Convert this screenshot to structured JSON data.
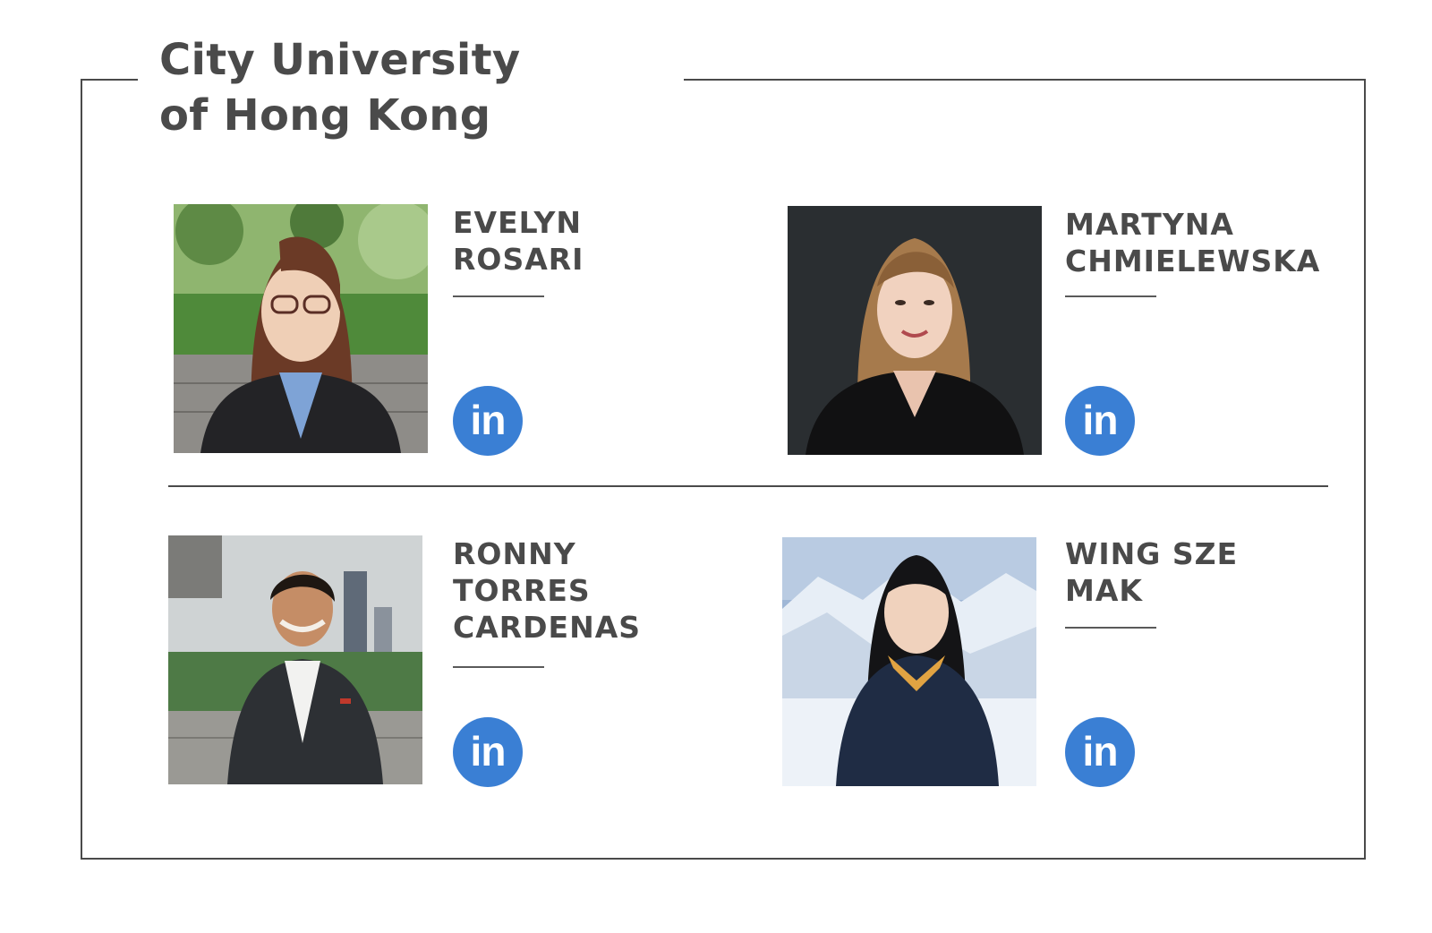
{
  "header": {
    "title_line1": "City University",
    "title_line2": "of Hong Kong"
  },
  "people": [
    {
      "name_line1": "EVELYN",
      "name_line2": "ROSARI",
      "name_line3": "",
      "linkedin_label": "in"
    },
    {
      "name_line1": "MARTYNA",
      "name_line2": "CHMIELEWSKA",
      "name_line3": "",
      "linkedin_label": "in"
    },
    {
      "name_line1": "RONNY",
      "name_line2": "TORRES",
      "name_line3": "CARDENAS",
      "linkedin_label": "in"
    },
    {
      "name_line1": "WING SZE",
      "name_line2": "MAK",
      "name_line3": "",
      "linkedin_label": "in"
    }
  ],
  "icons": {
    "social": "linkedin-icon"
  },
  "colors": {
    "text": "#4a4a4a",
    "frame": "#4a4a4a",
    "linkedin_blue": "#3a7fd4",
    "background": "#ffffff"
  }
}
